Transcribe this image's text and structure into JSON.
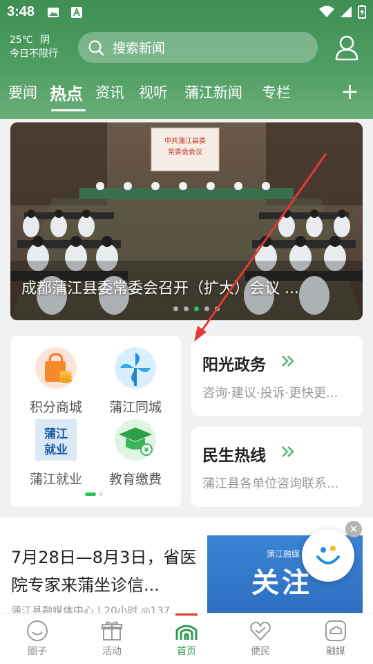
{
  "status_bar": {
    "time": "3:48"
  },
  "weather": {
    "temp": "25℃",
    "condition": "阴",
    "traffic": "今日不限行"
  },
  "search": {
    "placeholder": "搜索新闻"
  },
  "tabs": [
    {
      "label": "要闻"
    },
    {
      "label": "热点",
      "active": true
    },
    {
      "label": "资讯"
    },
    {
      "label": "视听"
    },
    {
      "label": "蒲江新闻"
    },
    {
      "label": "专栏"
    }
  ],
  "banner": {
    "caption": "成都蒲江县委常委会召开（扩大）会议 ...",
    "slide_count": 5,
    "active_slide": 3,
    "banner_sign": [
      "中共蒲江县委",
      "常委会会议"
    ]
  },
  "services": [
    {
      "label": "积分商城",
      "icon": "shopping-bag-icon"
    },
    {
      "label": "蒲江同城",
      "icon": "pinwheel-icon"
    },
    {
      "label": "蒲江就业",
      "icon": "employment-logo-icon",
      "logo_text": "蒲江就业"
    },
    {
      "label": "教育缴费",
      "icon": "graduation-cap-icon"
    }
  ],
  "cards": {
    "sunshine": {
      "title": "阳光政务",
      "subtitle": "咨询·建议·投诉·更快更..."
    },
    "hotline": {
      "title": "民生热线",
      "subtitle": "蒲江县各单位咨询联系..."
    }
  },
  "news": {
    "title": "7月28日—8月3日，省医院专家来蒲坐诊信...",
    "meta": "蒲江县融媒体中心 | 20小时 ◎137",
    "thumb_small": "蒲江融媒",
    "thumb_big": "关注"
  },
  "bottom_nav": [
    {
      "label": "圈子",
      "icon": "circle-smile-icon"
    },
    {
      "label": "活动",
      "icon": "gift-icon"
    },
    {
      "label": "首页",
      "icon": "home-logo-icon",
      "active": true
    },
    {
      "label": "便民",
      "icon": "heart-hand-icon"
    },
    {
      "label": "融媒",
      "icon": "media-icon"
    }
  ],
  "colors": {
    "brand_green": "#4e9d62",
    "accent_green": "#2fbf5b",
    "annotation_red": "#e53935"
  }
}
